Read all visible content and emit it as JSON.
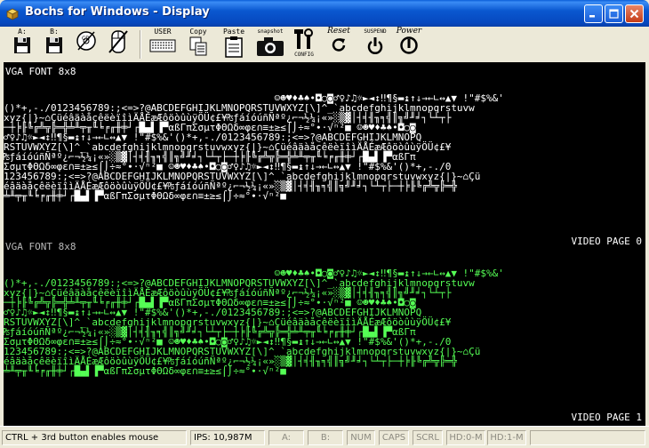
{
  "window": {
    "title": "Bochs for Windows - Display",
    "controls": {
      "minimize": "minimize",
      "maximize": "maximize",
      "close": "close"
    }
  },
  "toolbar": {
    "floppy_a": "A:",
    "floppy_b": "B:",
    "cdrom": "CD",
    "user": "USER",
    "copy": "Copy",
    "paste": "Paste",
    "snapshot": "snapshot",
    "config": "CONFIG",
    "reset": "Reset",
    "suspend": "SUSPEND",
    "power": "Power"
  },
  "display": {
    "page0_header": "VGA FONT 8x8",
    "page0_label": "VIDEO PAGE 0",
    "page1_header": "VGA FONT 8x8",
    "page1_label": "VIDEO PAGE 1",
    "page0_color": "#ffffff",
    "page1_color": "#55ff55"
  },
  "statusbar": {
    "message": "CTRL + 3rd button enables mouse",
    "ips": "IPS: 10,987M",
    "a": "A:",
    "b": "B:",
    "num": "NUM",
    "caps": "CAPS",
    "scrl": "SCRL",
    "hd0": "HD:0-M",
    "hd1": "HD:1-M"
  }
}
